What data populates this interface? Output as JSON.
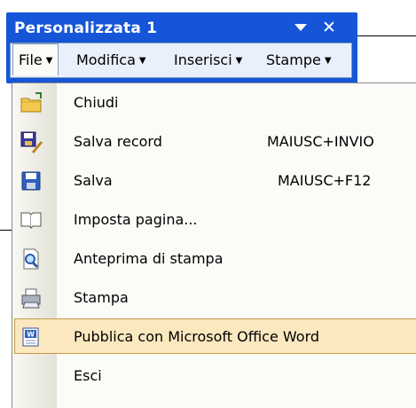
{
  "window": {
    "title": "Personalizzata 1"
  },
  "menubar": {
    "items": [
      {
        "label": "File"
      },
      {
        "label": "Modifica"
      },
      {
        "label": "Inserisci"
      },
      {
        "label": "Stampe"
      }
    ]
  },
  "menu": {
    "items": [
      {
        "label": "Chiudi",
        "shortcut": "",
        "icon": "folder-close-icon"
      },
      {
        "label": "Salva record",
        "shortcut": "MAIUSC+INVIO",
        "icon": "save-record-icon"
      },
      {
        "label": "Salva",
        "shortcut": "MAIUSC+F12",
        "icon": "floppy-disk-icon"
      },
      {
        "label": "Imposta pagina...",
        "shortcut": "",
        "icon": "page-setup-icon"
      },
      {
        "label": "Anteprima di stampa",
        "shortcut": "",
        "icon": "print-preview-icon"
      },
      {
        "label": "Stampa",
        "shortcut": "",
        "icon": "printer-icon"
      },
      {
        "label": "Pubblica con Microsoft Office Word",
        "shortcut": "",
        "icon": "word-icon",
        "highlighted": true
      },
      {
        "label": "Esci",
        "shortcut": "",
        "icon": ""
      }
    ]
  },
  "colors": {
    "titlebar": "#1556d8",
    "menubar": "#e9f0fb",
    "highlight": "#fbe8bf",
    "highlight_border": "#c69a45"
  }
}
